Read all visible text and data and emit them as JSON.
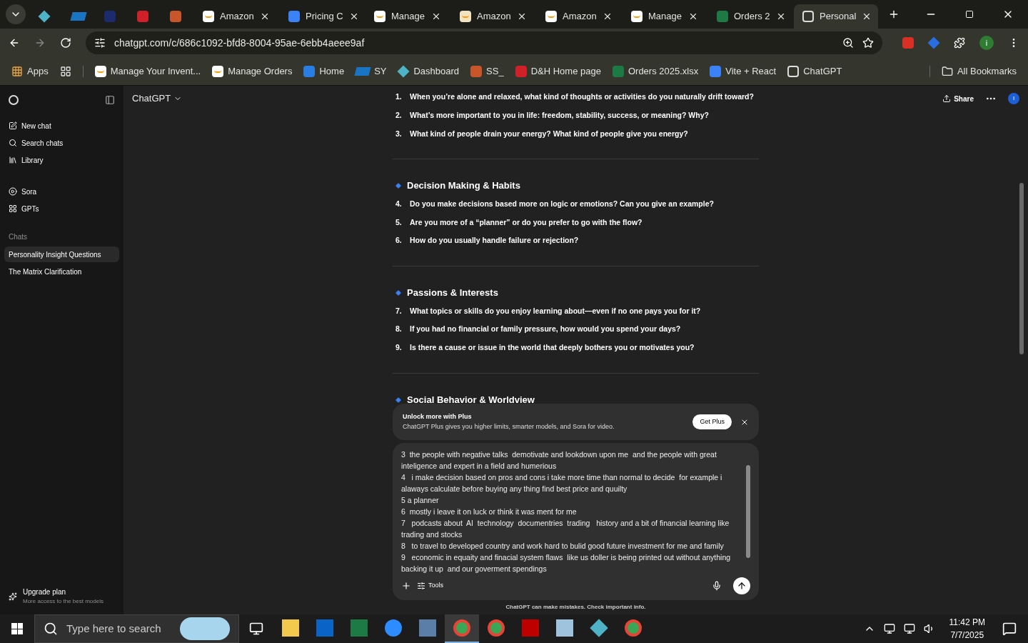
{
  "browser": {
    "tabs": [
      {
        "selected": false
      },
      {
        "selected": false
      },
      {
        "selected": false
      },
      {
        "selected": false
      },
      {
        "selected": false
      },
      {
        "label": "Amazon",
        "selected": false
      },
      {
        "label": "Pricing C",
        "selected": false
      },
      {
        "label": "Manage",
        "selected": false
      },
      {
        "label": "Amazon",
        "selected": false
      },
      {
        "label": "Amazon",
        "selected": false
      },
      {
        "label": "Manage",
        "selected": false
      },
      {
        "label": "Orders 2",
        "selected": false
      },
      {
        "label": "Personal",
        "selected": true
      }
    ],
    "address": "chatgpt.com/c/686c1092-bfd8-8004-95ae-6ebb4aeee9af",
    "profile": "i",
    "apps": "Apps",
    "bookmarks": [
      {
        "label": "Manage Your Invent..."
      },
      {
        "label": "Manage Orders"
      },
      {
        "label": "Home"
      },
      {
        "label": "SY"
      },
      {
        "label": "Dashboard"
      },
      {
        "label": "SS_"
      },
      {
        "label": "D&H Home page"
      },
      {
        "label": "Orders 2025.xlsx"
      },
      {
        "label": "Vite + React"
      },
      {
        "label": "ChatGPT"
      }
    ],
    "all_bookmarks": "All Bookmarks"
  },
  "sidebar": {
    "items": [
      {
        "label": "New chat"
      },
      {
        "label": "Search chats"
      },
      {
        "label": "Library"
      },
      {
        "label": "Sora"
      },
      {
        "label": "GPTs"
      }
    ],
    "chats_heading": "Chats",
    "chats": [
      {
        "label": "Personality Insight Questions",
        "selected": true
      },
      {
        "label": "The Matrix Clarification",
        "selected": false
      }
    ],
    "upgrade": {
      "title": "Upgrade plan",
      "subtitle": "More access to the best models"
    }
  },
  "header": {
    "model": "ChatGPT",
    "share": "Share",
    "avatar": "I"
  },
  "sections": [
    {
      "questions": [
        {
          "number": "1.",
          "text": "When you’re alone and relaxed, what kind of thoughts or activities do you naturally drift toward?"
        },
        {
          "number": "2.",
          "text": "What’s more important to you in life: freedom, stability, success, or meaning? Why?"
        },
        {
          "number": "3.",
          "text": "What kind of people drain your energy? What kind of people give you energy?"
        }
      ]
    },
    {
      "heading": "Decision Making & Habits",
      "questions": [
        {
          "number": "4.",
          "text": "Do you make decisions based more on logic or emotions? Can you give an example?"
        },
        {
          "number": "5.",
          "text": "Are you more of a “planner” or do you prefer to go with the flow?"
        },
        {
          "number": "6.",
          "text": "How do you usually handle failure or rejection?"
        }
      ]
    },
    {
      "heading": "Passions & Interests",
      "questions": [
        {
          "number": "7.",
          "text": "What topics or skills do you enjoy learning about—even if no one pays you for it?"
        },
        {
          "number": "8.",
          "text": "If you had no financial or family pressure, how would you spend your days?"
        },
        {
          "number": "9.",
          "text": "Is there a cause or issue in the world that deeply bothers you or motivates you?"
        }
      ]
    },
    {
      "heading": "Social Behavior & Worldview"
    }
  ],
  "banner": {
    "title": "Unlock more with Plus",
    "text": "ChatGPT Plus gives you higher limits, smarter models, and Sora for video.",
    "button": "Get Plus"
  },
  "composer": {
    "value": "3  the people with negative talks  demotivate and lookdown upon me  and the people with great inteligence and expert in a field and humerious\n4   i make decision based on pros and cons i take more time than normal to decide  for example i alaways calculate before buying any thing find best price and quuilty\n5 a planner\n6  mostly i leave it on luck or think it was ment for me\n7   podcasts about  AI  technology  documentries  trading   history and a bit of financial learning like trading and stocks\n8   to travel to developed country and work hard to bulid good future investment for me and family\n9   economic in equaity and finacial system flaws  like us doller is being printed out without anything backing it up  and our goverment spendings",
    "tools": "Tools"
  },
  "disclaimer": "ChatGPT can make mistakes. Check important info.",
  "taskbar": {
    "search_placeholder": "Type here to search",
    "apps": [
      {
        "selected": false
      },
      {
        "selected": false
      },
      {
        "selected": false
      },
      {
        "selected": false
      },
      {
        "selected": false
      },
      {
        "selected": true
      },
      {
        "selected": false
      },
      {
        "selected": false
      },
      {
        "selected": false
      },
      {
        "selected": false
      },
      {
        "selected": false
      }
    ],
    "time": "11:42 PM",
    "date": "7/7/2025"
  }
}
